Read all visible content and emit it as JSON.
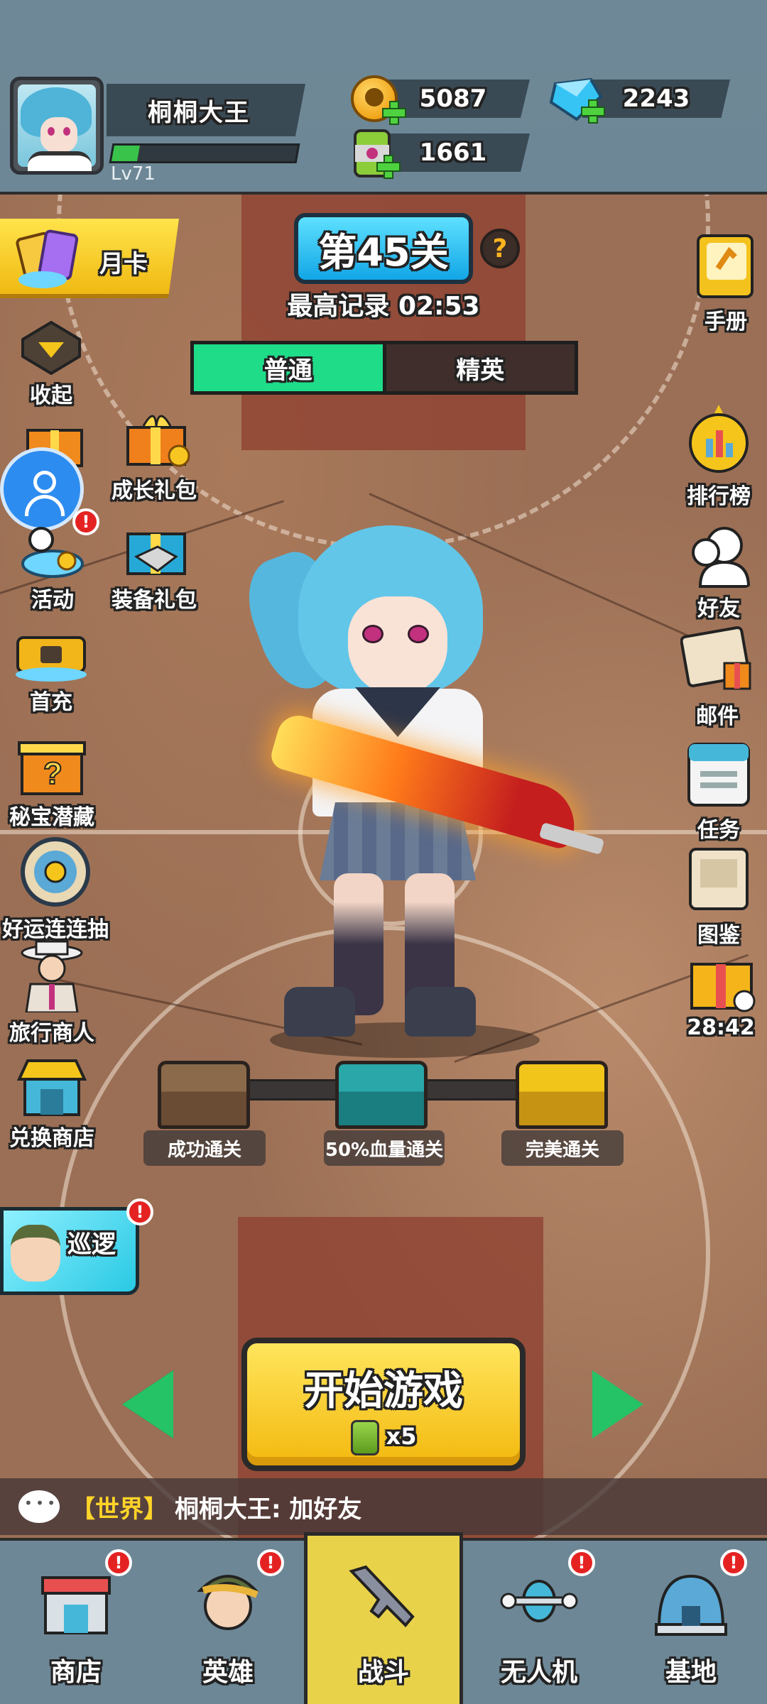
{
  "player": {
    "name": "桐桐大王",
    "level": "Lv71",
    "xp_fraction": 0.14
  },
  "resources": {
    "gold": "5087",
    "gems": "2243",
    "energy": "1661"
  },
  "stage": {
    "title": "第45关",
    "best_record": "最高记录 02:53",
    "help": "?",
    "modes": [
      "普通",
      "精英"
    ]
  },
  "left_menu": {
    "monthly_card": "月卡",
    "collapse": "收起",
    "growth_pack": "成长礼包",
    "events": "活动",
    "equipment_pack": "装备礼包",
    "first_topup": "首充",
    "treasure": "秘宝潜藏",
    "lucky_draw": "好运连连抽",
    "merchant": "旅行商人",
    "exchange_shop": "兑换商店",
    "patrol": "巡逻",
    "badge": "!"
  },
  "right_menu": {
    "handbook": "手册",
    "leaderboard": "排行榜",
    "friends": "好友",
    "mail": "邮件",
    "tasks": "任务",
    "collection": "图鉴",
    "timer": "28:42"
  },
  "chests": [
    "成功通关",
    "50%血量通关",
    "完美通关"
  ],
  "start": {
    "label": "开始游戏",
    "cost": "x5"
  },
  "chat": {
    "channel": "【世界】",
    "message": "桐桐大王: 加好友"
  },
  "nav": {
    "items": [
      "商店",
      "英雄",
      "战斗",
      "无人机",
      "基地"
    ],
    "badge": "!"
  },
  "colors": {
    "accent_green": "#1fdc89",
    "stage_blue": "#12a6e6",
    "start_yellow": "#f3b90f",
    "header": "#6d8796"
  }
}
